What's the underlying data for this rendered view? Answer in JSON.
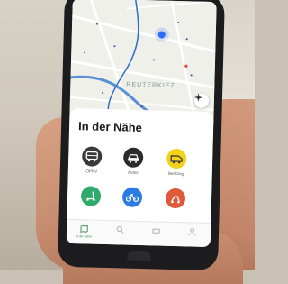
{
  "map": {
    "district_label": "REUTERKIEZ"
  },
  "sheet": {
    "title": "In der Nähe",
    "categories": [
      {
        "label": "ÖPNV",
        "icon": "bus-icon",
        "color": "#3a3a3c"
      },
      {
        "label": "Autos",
        "icon": "car-icon",
        "color": "#2b2b2d"
      },
      {
        "label": "Bentzing",
        "icon": "van-icon",
        "color": "#f2d21a"
      },
      {
        "label": "",
        "icon": "scooter-icon",
        "color": "#2eaa6a"
      },
      {
        "label": "",
        "icon": "bicycle-icon",
        "color": "#2c7be5"
      },
      {
        "label": "",
        "icon": "moped-icon",
        "color": "#e05a3a"
      }
    ]
  },
  "tabbar": {
    "tabs": [
      {
        "label": "In der Nähe",
        "icon": "map-icon",
        "active": true
      },
      {
        "label": "",
        "icon": "search-icon",
        "active": false
      },
      {
        "label": "",
        "icon": "ticket-icon",
        "active": false
      },
      {
        "label": "",
        "icon": "profile-icon",
        "active": false
      }
    ]
  }
}
